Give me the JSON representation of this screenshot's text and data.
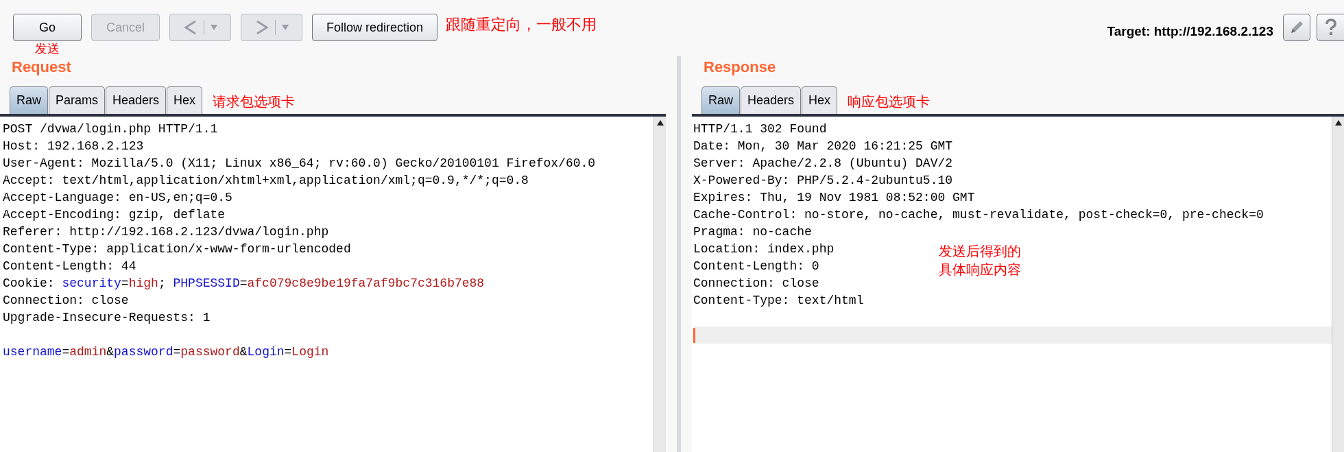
{
  "toolbar": {
    "buttons": [
      {
        "kind": "text",
        "label": "Go",
        "disabled": false
      },
      {
        "kind": "text",
        "label": "Cancel",
        "disabled": true
      },
      {
        "kind": "back",
        "disabled": true
      },
      {
        "kind": "forward",
        "disabled": true
      },
      {
        "kind": "text",
        "label": "Follow redirection",
        "disabled": false
      }
    ],
    "note": "跟随重定向，一般不用",
    "go_note": "发送",
    "target": "Target: http://192.168.2.123"
  },
  "request": {
    "title": "Request",
    "tabs": [
      {
        "label": "Raw",
        "selected": true
      },
      {
        "label": "Params",
        "selected": false
      },
      {
        "label": "Headers",
        "selected": false
      },
      {
        "label": "Hex",
        "selected": false
      }
    ],
    "tabs_note": "请求包选项卡",
    "lines": [
      {
        "parts": [
          {
            "kind": "plain",
            "text": "POST /dvwa/login.php HTTP/1.1"
          }
        ]
      },
      {
        "parts": [
          {
            "kind": "plain",
            "text": "Host: 192.168.2.123"
          }
        ]
      },
      {
        "parts": [
          {
            "kind": "plain",
            "text": "User-Agent: Mozilla/5.0 (X11; Linux x86_64; rv:60.0) Gecko/20100101 Firefox/60.0"
          }
        ]
      },
      {
        "parts": [
          {
            "kind": "plain",
            "text": "Accept: text/html,application/xhtml+xml,application/xml;q=0.9,*/*;q=0.8"
          }
        ]
      },
      {
        "parts": [
          {
            "kind": "plain",
            "text": "Accept-Language: en-US,en;q=0.5"
          }
        ]
      },
      {
        "parts": [
          {
            "kind": "plain",
            "text": "Accept-Encoding: gzip, deflate"
          }
        ]
      },
      {
        "parts": [
          {
            "kind": "plain",
            "text": "Referer: http://192.168.2.123/dvwa/login.php"
          }
        ]
      },
      {
        "parts": [
          {
            "kind": "plain",
            "text": "Content-Type: application/x-www-form-urlencoded"
          }
        ]
      },
      {
        "parts": [
          {
            "kind": "plain",
            "text": "Content-Length: 44"
          }
        ]
      },
      {
        "parts": [
          {
            "kind": "plain",
            "text": "Cookie: "
          },
          {
            "kind": "name",
            "text": "security"
          },
          {
            "kind": "plain",
            "text": "="
          },
          {
            "kind": "value",
            "text": "high"
          },
          {
            "kind": "plain",
            "text": "; "
          },
          {
            "kind": "name",
            "text": "PHPSESSID"
          },
          {
            "kind": "plain",
            "text": "="
          },
          {
            "kind": "value",
            "text": "afc079c8e9be19fa7af9bc7c316b7e88"
          }
        ]
      },
      {
        "parts": [
          {
            "kind": "plain",
            "text": "Connection: close"
          }
        ]
      },
      {
        "parts": [
          {
            "kind": "plain",
            "text": "Upgrade-Insecure-Requests: 1"
          }
        ]
      },
      {
        "gap_before": true,
        "parts": [
          {
            "kind": "name",
            "text": "username"
          },
          {
            "kind": "plain",
            "text": "="
          },
          {
            "kind": "value",
            "text": "admin"
          },
          {
            "kind": "plain",
            "text": "&"
          },
          {
            "kind": "name",
            "text": "password"
          },
          {
            "kind": "plain",
            "text": "="
          },
          {
            "kind": "value",
            "text": "password"
          },
          {
            "kind": "plain",
            "text": "&"
          },
          {
            "kind": "name",
            "text": "Login"
          },
          {
            "kind": "plain",
            "text": "="
          },
          {
            "kind": "value",
            "text": "Login"
          }
        ]
      }
    ]
  },
  "response": {
    "title": "Response",
    "tabs": [
      {
        "label": "Raw",
        "selected": true
      },
      {
        "label": "Headers",
        "selected": false
      },
      {
        "label": "Hex",
        "selected": false
      }
    ],
    "tabs_note": "响应包选项卡",
    "lines": [
      "HTTP/1.1 302 Found",
      "Date: Mon, 30 Mar 2020 16:21:25 GMT",
      "Server: Apache/2.2.8 (Ubuntu) DAV/2",
      "X-Powered-By: PHP/5.2.4-2ubuntu5.10",
      "Expires: Thu, 19 Nov 1981 08:52:00 GMT",
      "Cache-Control: no-store, no-cache, must-revalidate, post-check=0, pre-check=0",
      "Pragma: no-cache",
      "Location: index.php",
      "Content-Length: 0",
      "Connection: close",
      "Content-Type: text/html"
    ],
    "note_lines": [
      "发送后得到的",
      "具体响应内容"
    ]
  }
}
